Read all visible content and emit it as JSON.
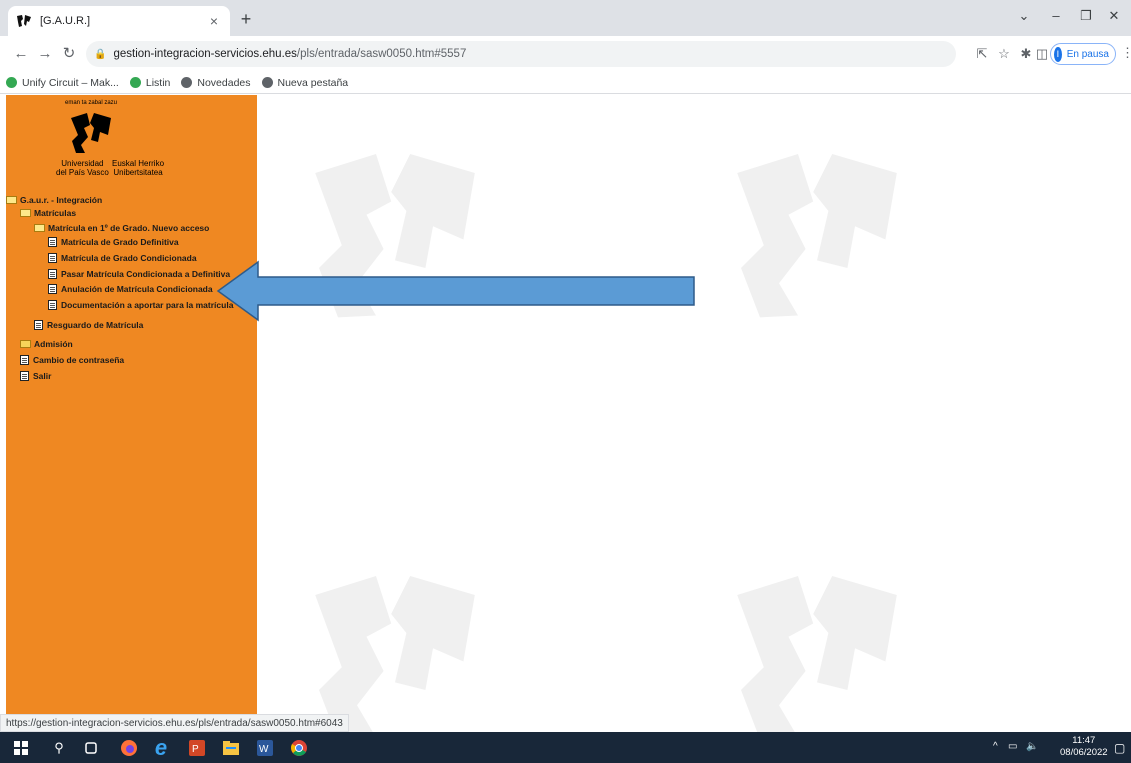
{
  "browser": {
    "tab_title": "[G.A.U.R.]",
    "close_glyph": "×",
    "newtab_glyph": "+",
    "url_host": "gestion-integracion-servicios.ehu.es",
    "url_path": "/pls/entrada/sasw0050.htm#5557",
    "profile_initial": "I",
    "profile_label": "En pausa",
    "bookmarks": [
      "Unify Circuit – Mak...",
      "Listin",
      "Novedades",
      "Nueva pestaña"
    ]
  },
  "logo": {
    "motto": "eman ta zabal zazu",
    "name_es_1": "Universidad",
    "name_es_2": "del País Vasco",
    "name_eu_1": "Euskal Herriko",
    "name_eu_2": "Unibertsitatea"
  },
  "tree": {
    "root": "G.a.u.r. - Integración",
    "matriculas": "Matrículas",
    "matricula_primero": "Matrícula en 1º de Grado. Nuevo acceso",
    "items": [
      "Matrícula de Grado Definitiva",
      "Matrícula de Grado Condicionada",
      "Pasar Matrícula Condicionada a Definitiva",
      "Anulación de Matrícula Condicionada",
      "Documentación a aportar para la matrícula"
    ],
    "resguardo": "Resguardo de Matrícula",
    "admision": "Admisión",
    "cambio": "Cambio de contraseña",
    "salir": "Salir"
  },
  "status_url": "https://gestion-integracion-servicios.ehu.es/pls/entrada/sasw0050.htm#6043",
  "clock": {
    "time": "11:47",
    "date": "08/06/2022"
  },
  "colors": {
    "sidebar": "#ef8822",
    "arrow_fill": "#5b9bd5",
    "arrow_stroke": "#2e5b8a",
    "taskbar": "#182739"
  },
  "annotation": {
    "type": "arrow",
    "direction": "left",
    "points_to": "Anulación de Matrícula Condicionada"
  }
}
